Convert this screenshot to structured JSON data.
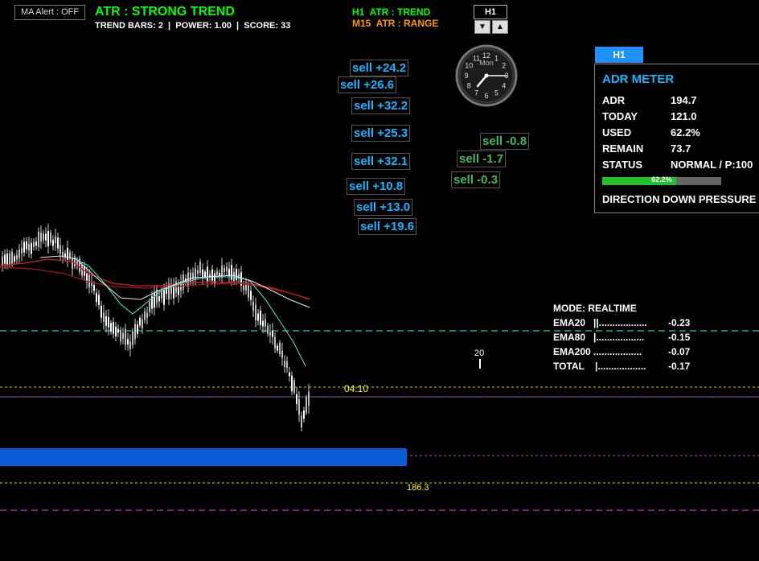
{
  "ma_alert": {
    "label": "MA Alert : OFF"
  },
  "atr": {
    "title": "ATR : STRONG TREND",
    "subtitle": "TREND BARS: 2  |  POWER: 1.00  |  SCORE: 33",
    "h1": "H1  ATR : TREND",
    "m15": "M15  ATR : RANGE"
  },
  "timeframe": {
    "label": "H1",
    "down_symbol": "▼",
    "up_symbol": "▲"
  },
  "clock": {
    "day": "Mon",
    "numbers": [
      "12",
      "1",
      "2",
      "3",
      "4",
      "5",
      "6",
      "7",
      "8",
      "9",
      "10",
      "11"
    ],
    "hour_hand_deg": 220,
    "minute_hand_deg": 90
  },
  "signals_blue": [
    "sell +24.2",
    "sell +26.6",
    "sell +32.2",
    "sell +25.3",
    "sell +32.1",
    "sell +10.8",
    "sell +13.0",
    "sell +19.6"
  ],
  "signals_green": [
    "sell -0.8",
    "sell -1.7",
    "sell -0.3"
  ],
  "adr": {
    "tab": "H1",
    "title": "ADR METER",
    "rows": [
      {
        "label": "ADR",
        "value": "194.7"
      },
      {
        "label": "TODAY",
        "value": "121.0"
      },
      {
        "label": "USED",
        "value": "62.2%"
      },
      {
        "label": "REMAIN",
        "value": "73.7"
      },
      {
        "label": "STATUS",
        "value": "NORMAL / P:100"
      }
    ],
    "bar_fraction": 0.622,
    "bar_label": "62.2%",
    "direction": "DIRECTION DOWN PRESSURE"
  },
  "ema_panel": {
    "mode": "MODE: REALTIME",
    "rows": [
      {
        "label": "EMA20   ||..................",
        "value": "-0.23"
      },
      {
        "label": "EMA80   |..................",
        "value": "-0.15"
      },
      {
        "label": "EMA200 ..................",
        "value": "-0.07"
      },
      {
        "label": "TOTAL    |..................",
        "value": "-0.17"
      }
    ]
  },
  "countdown": "04:10",
  "price_label": "186.3",
  "marker_label": "20",
  "colors": {
    "accent_blue": "#19b5ff",
    "signal_green": "#44b860",
    "trend_green": "#00ff00",
    "range_orange": "#ff9900",
    "zone_blue": "#0a5bd6"
  }
}
